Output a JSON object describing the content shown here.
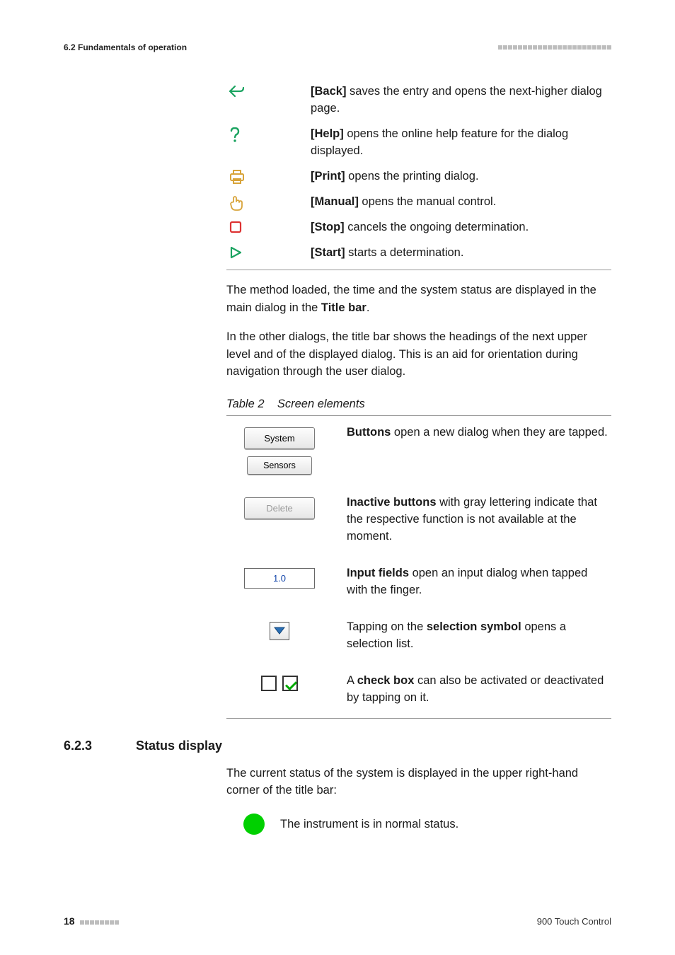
{
  "header": {
    "section_label": "6.2 Fundamentals of operation"
  },
  "icon_rows": [
    {
      "bold": "[Back]",
      "rest": " saves the entry and opens the next-higher dialog page."
    },
    {
      "bold": "[Help]",
      "rest": " opens the online help feature for the dialog displayed."
    },
    {
      "bold": "[Print]",
      "rest": " opens the printing dialog."
    },
    {
      "bold": "[Manual]",
      "rest": " opens the manual control."
    },
    {
      "bold": "[Stop]",
      "rest": " cancels the ongoing determination."
    },
    {
      "bold": "[Start]",
      "rest": " starts a determination."
    }
  ],
  "para1_a": "The method loaded, the time and the system status are displayed in the main dialog in the ",
  "para1_b": "Title bar",
  "para1_c": ".",
  "para2": "In the other dialogs, the title bar shows the headings of the next upper level and of the displayed dialog. This is an aid for orientation during navigation through the user dialog.",
  "table2_caption_a": "Table 2",
  "table2_caption_b": "Screen elements",
  "btn_system": "System",
  "btn_sensors": "Sensors",
  "btn_delete": "Delete",
  "input_value": "1.0",
  "row_buttons_a": "Buttons",
  "row_buttons_b": " open a new dialog when they are tapped.",
  "row_inactive_a": "Inactive buttons",
  "row_inactive_b": " with gray lettering indicate that the respective function is not available at the moment.",
  "row_input_a": "Input fields",
  "row_input_b": " open an input dialog when tapped with the finger.",
  "row_sel_a": "Tapping on the ",
  "row_sel_b": "selection symbol",
  "row_sel_c": " opens a selection list.",
  "row_cb_a": "A ",
  "row_cb_b": "check box",
  "row_cb_c": " can also be activated or deactivated by tapping on it.",
  "section_num": "6.2.3",
  "section_title": "Status display",
  "status_para": "The current status of the system is displayed in the upper right-hand corner of the title bar:",
  "status_normal": "The instrument is in normal status.",
  "footer_page": "18",
  "footer_right": "900 Touch Control"
}
